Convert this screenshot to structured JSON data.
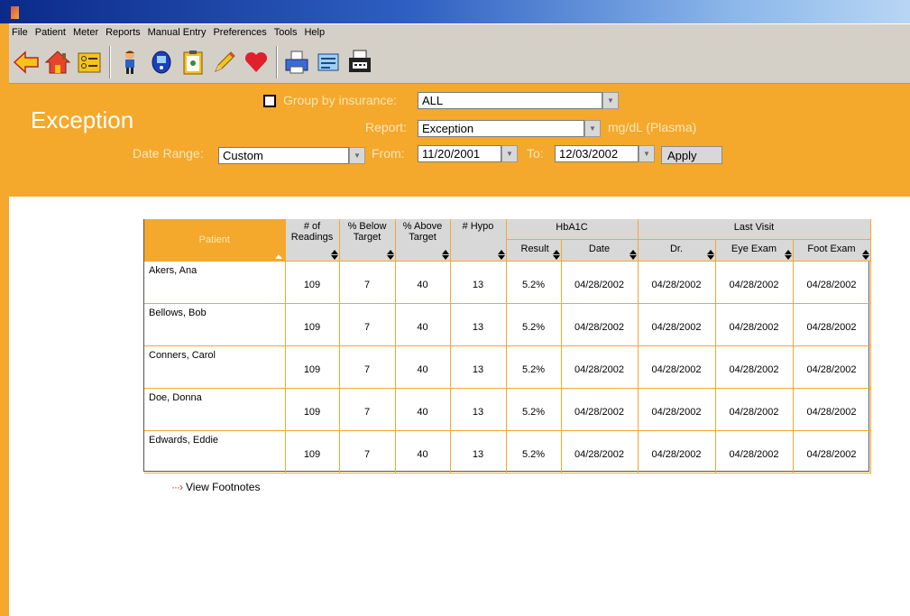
{
  "menu": [
    "File",
    "Patient",
    "Meter",
    "Reports",
    "Manual Entry",
    "Preferences",
    "Tools",
    "Help"
  ],
  "toolbar": {
    "icons": [
      "back-arrow-icon",
      "home-icon",
      "patient-list-icon",
      "patient-icon",
      "meter-icon",
      "clipboard-icon",
      "pencil-icon",
      "heart-icon",
      "printer-icon",
      "report-icon",
      "fax-icon"
    ]
  },
  "header": {
    "title": "Exception",
    "group_by_label": "Group by insurance:",
    "group_by_value": "ALL",
    "report_label": "Report:",
    "report_value": "Exception",
    "units": "mg/dL (Plasma)",
    "date_range_label": "Date Range:",
    "date_range_value": "Custom",
    "from_label": "From:",
    "from_value": "11/20/2001",
    "to_label": "To:",
    "to_value": "12/03/2002",
    "apply_label": "Apply"
  },
  "table": {
    "headers": {
      "patient": "Patient",
      "readings_1": "# of",
      "readings_2": "Readings",
      "below_1": "% Below",
      "below_2": "Target",
      "above_1": "% Above",
      "above_2": "Target",
      "hypo": "# Hypo",
      "hba1c": "HbA1C",
      "result": "Result",
      "date": "Date",
      "last_visit": "Last Visit",
      "dr": "Dr.",
      "eye": "Eye Exam",
      "foot": "Foot Exam"
    },
    "rows": [
      {
        "name": "Akers, Ana",
        "readings": "109",
        "below": "7",
        "above": "40",
        "hypo": "13",
        "result": "5.2%",
        "date": "04/28/2002",
        "dr": "04/28/2002",
        "eye": "04/28/2002",
        "foot": "04/28/2002"
      },
      {
        "name": "Bellows, Bob",
        "readings": "109",
        "below": "7",
        "above": "40",
        "hypo": "13",
        "result": "5.2%",
        "date": "04/28/2002",
        "dr": "04/28/2002",
        "eye": "04/28/2002",
        "foot": "04/28/2002"
      },
      {
        "name": "Conners, Carol",
        "readings": "109",
        "below": "7",
        "above": "40",
        "hypo": "13",
        "result": "5.2%",
        "date": "04/28/2002",
        "dr": "04/28/2002",
        "eye": "04/28/2002",
        "foot": "04/28/2002"
      },
      {
        "name": "Doe, Donna",
        "readings": "109",
        "below": "7",
        "above": "40",
        "hypo": "13",
        "result": "5.2%",
        "date": "04/28/2002",
        "dr": "04/28/2002",
        "eye": "04/28/2002",
        "foot": "04/28/2002"
      },
      {
        "name": "Edwards, Eddie",
        "readings": "109",
        "below": "7",
        "above": "40",
        "hypo": "13",
        "result": "5.2%",
        "date": "04/28/2002",
        "dr": "04/28/2002",
        "eye": "04/28/2002",
        "foot": "04/28/2002"
      }
    ]
  },
  "footnotes_label": "View Footnotes",
  "colors": {
    "accent": "#f4a82c",
    "header_text": "#fde7b8",
    "chrome": "#d4d0c8"
  }
}
